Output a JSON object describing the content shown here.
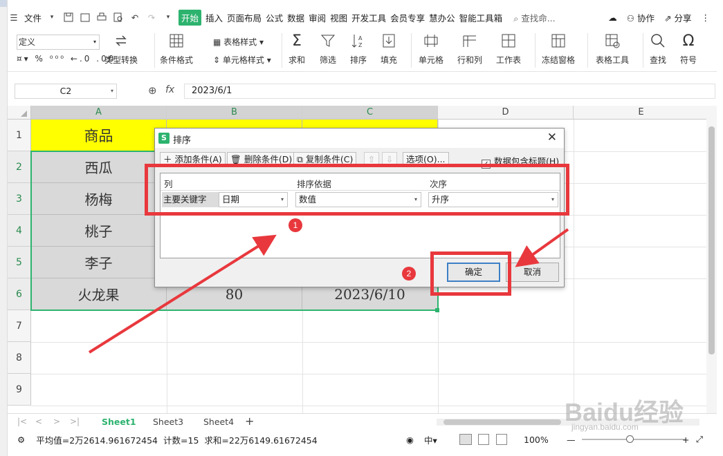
{
  "menu": {
    "file": "文件",
    "tabs": [
      "开始",
      "插入",
      "页面布局",
      "公式",
      "数据",
      "审阅",
      "视图",
      "开发工具",
      "会员专享",
      "慧办公",
      "智能工具箱"
    ],
    "search": "查找命...",
    "collab": "协作",
    "share": "分享"
  },
  "ribbon": {
    "number_format": "定义",
    "type_convert": "类型转换",
    "cond_format": "条件格式",
    "table_style": "表格样式",
    "cell_style": "单元格样式",
    "sum": "求和",
    "filter": "筛选",
    "sort": "排序",
    "fill": "填充",
    "cell": "单元格",
    "row_col": "行和列",
    "worksheet": "工作表",
    "freeze": "冻结窗格",
    "table_tools": "表格工具",
    "find": "查找",
    "symbol": "符号"
  },
  "formula_bar": {
    "name_box": "C2",
    "fx": "fx",
    "value": "2023/6/1"
  },
  "columns": [
    "A",
    "B",
    "C",
    "D",
    "E"
  ],
  "rows": [
    "1",
    "2",
    "3",
    "4",
    "5",
    "6",
    "7",
    "8",
    "9"
  ],
  "cells": {
    "a1": "商品",
    "a2": "西瓜",
    "a3": "杨梅",
    "a4": "桃子",
    "a5": "李子",
    "a6": "火龙果",
    "b6": "80",
    "c6": "2023/6/10"
  },
  "dialog": {
    "title": "排序",
    "add": "添加条件(A)",
    "delete": "删除条件(D)",
    "copy": "复制条件(C)",
    "options": "选项(O)...",
    "has_header": "数据包含标题(H)",
    "col_header": "列",
    "basis_header": "排序依据",
    "order_header": "次序",
    "primary_key": "主要关键字",
    "key_value": "日期",
    "basis_value": "数值",
    "order_value": "升序",
    "ok": "确定",
    "cancel": "取消"
  },
  "annotations": {
    "badge1": "1",
    "badge2": "2",
    "color": "#e8383d"
  },
  "sheets": [
    "Sheet1",
    "Sheet3",
    "Sheet4"
  ],
  "status": {
    "average": "平均值=2万2614.961672454",
    "count": "计数=15",
    "sum": "求和=22万6149.61672454",
    "zoom": "100%"
  },
  "watermark": {
    "logo": "Baidu经验",
    "url": "jingyan.baidu.com"
  },
  "colors": {
    "accent": "#2db36e",
    "header_fill": "#ffff00",
    "data_fill": "#d9d9d9"
  }
}
